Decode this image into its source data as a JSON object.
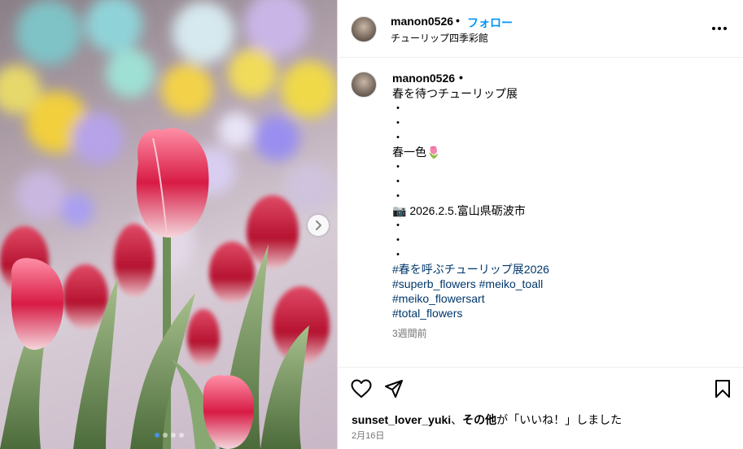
{
  "header": {
    "username": "manon0526",
    "separator": "•",
    "follow_label": "フォロー",
    "location": "チューリップ四季彩館"
  },
  "caption": {
    "username": "manon0526",
    "separator": "•",
    "lines": [
      "春を待つチューリップ展",
      "・",
      "・",
      "・",
      "春一色🌷",
      "・",
      "・",
      "・",
      "📷 2026.2.5.富山県砺波市",
      "・",
      "・",
      "・"
    ],
    "hashtags": [
      [
        "#春を呼ぶチューリップ展2026"
      ],
      [
        "#superb_flowers",
        "#meiko_toall"
      ],
      [
        "#meiko_flowersart"
      ],
      [
        "#total_flowers"
      ]
    ],
    "time_ago": "3週間前"
  },
  "likes": {
    "user": "sunset_lover_yuki",
    "connector": "、",
    "others": "その他",
    "suffix": "が「いいね！」しました"
  },
  "post_date": "2月16日",
  "icons": {
    "more": "more-options-icon",
    "like": "heart-icon",
    "share": "share-icon",
    "save": "bookmark-icon",
    "next": "chevron-right-icon"
  },
  "colors": {
    "link_blue": "#0095f6",
    "hashtag": "#00376b",
    "muted": "#737373"
  }
}
